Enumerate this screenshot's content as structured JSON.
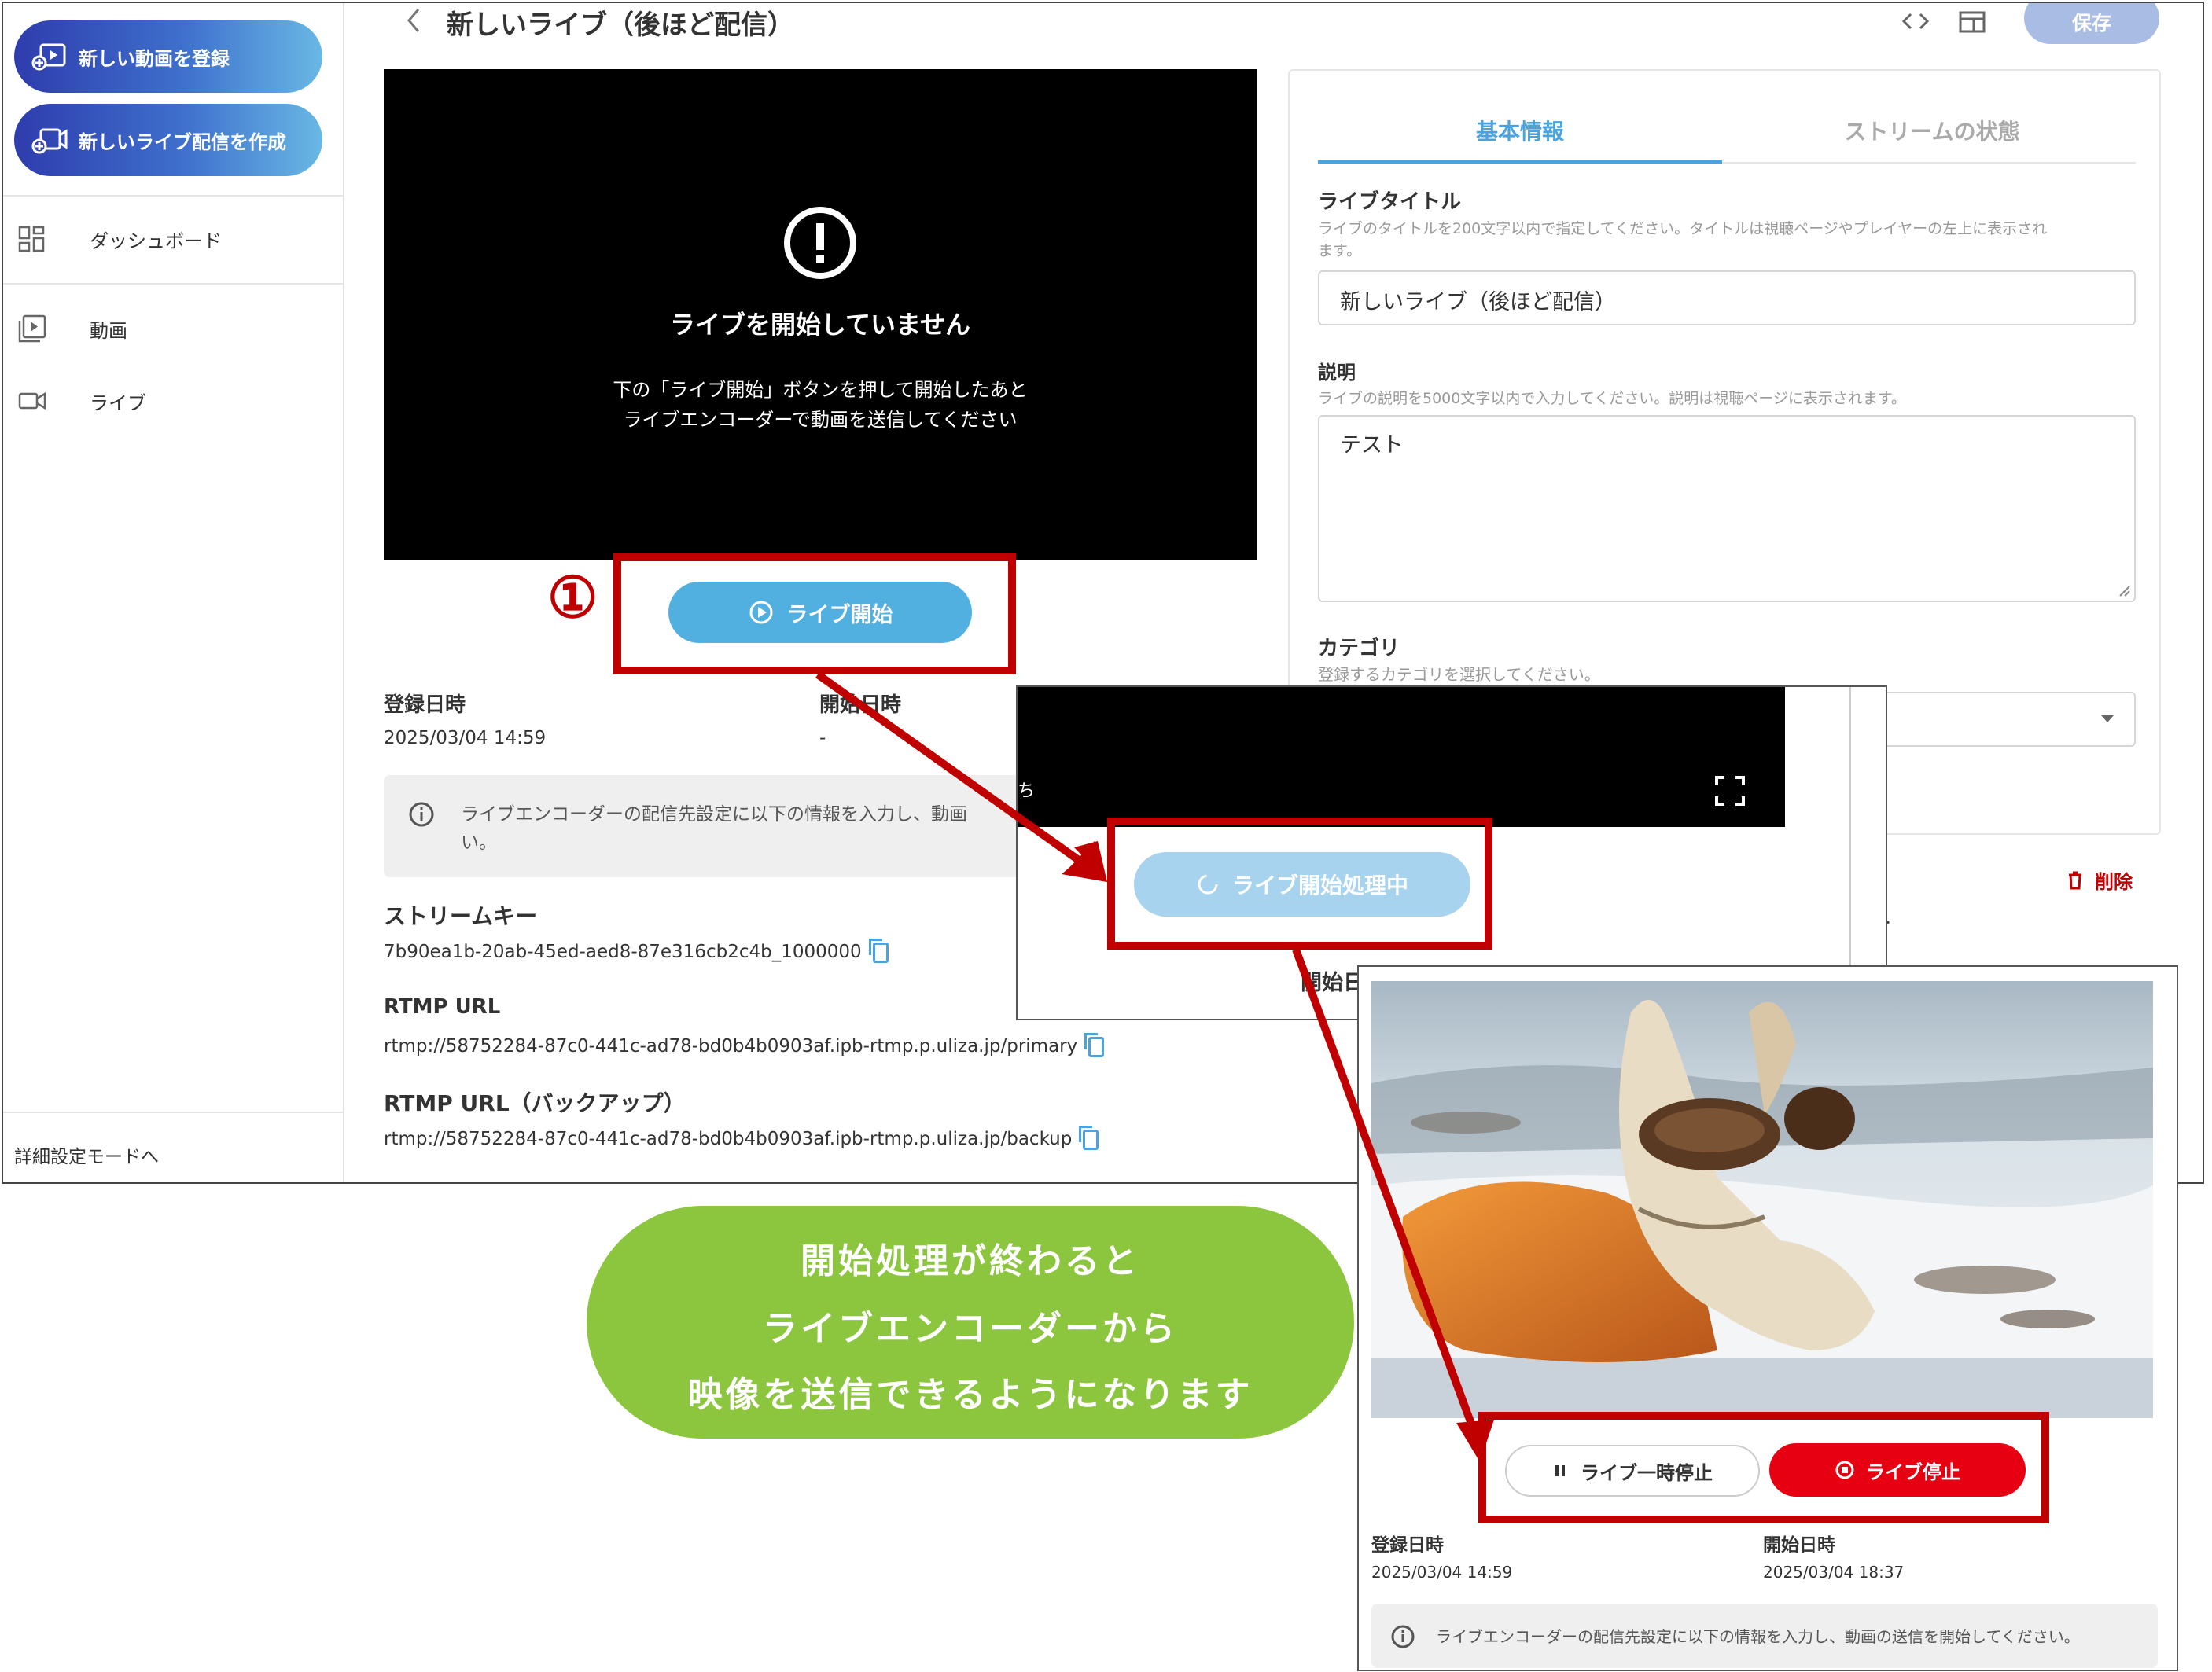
{
  "sidebar": {
    "register_video": "新しい動画を登録",
    "create_live": "新しいライブ配信を作成",
    "nav": [
      "ダッシュボード",
      "動画",
      "ライブ"
    ],
    "advanced_mode": "詳細設定モードへ"
  },
  "header": {
    "title": "新しいライブ（後ほど配信）",
    "save": "保存"
  },
  "player": {
    "heading": "ライブを開始していません",
    "line1": "下の「ライブ開始」ボタンを押して開始したあと",
    "line2": "ライブエンコーダーで動画を送信してください"
  },
  "step_marker": "①",
  "start_button": "ライブ開始",
  "info": {
    "registered_label": "登録日時",
    "registered_value": "2025/03/04 14:59",
    "started_label": "開始日時",
    "started_value": "-",
    "notice": "ライブエンコーダーの配信先設定に以下の情報を入力し、動画",
    "notice_tail": "い。",
    "stream_key_label": "ストリームキー",
    "stream_key": "7b90ea1b-20ab-45ed-aed8-87e316cb2c4b_1000000",
    "rtmp_label": "RTMP URL",
    "rtmp": "rtmp://58752284-87c0-441c-ad78-bd0b4b0903af.ipb-rtmp.p.uliza.jp/primary",
    "rtmp_backup_label": "RTMP URL（バックアップ）",
    "rtmp_backup": "rtmp://58752284-87c0-441c-ad78-bd0b4b0903af.ipb-rtmp.p.uliza.jp/backup"
  },
  "panel": {
    "tab_basic": "基本情報",
    "tab_stream": "ストリームの状態",
    "title_label": "ライブタイトル",
    "title_hint": "ライブのタイトルを200文字以内で指定してください。タイトルは視聴ページやプレイヤーの左上に表示され",
    "title_hint2": "ます。",
    "title_value": "新しいライブ（後ほど配信）",
    "desc_label": "説明",
    "desc_hint": "ライブの説明を5000文字以内で入力してください。説明は視聴ページに表示されます。",
    "desc_value": "テスト",
    "category_label": "カテゴリ",
    "category_hint": "登録するカテゴリを選択してください。",
    "delete": "削除",
    "cut_ka": "カテ",
    "cut_reg": "登録"
  },
  "overlay_mid": {
    "side_text": "ち",
    "processing": "ライブ開始処理中",
    "cut_start": "開始日"
  },
  "callout": {
    "line1": "開始処理が終わると",
    "line2": "ライブエンコーダーから",
    "line3": "映像を送信できるようになります"
  },
  "overlay_bottom": {
    "pause": "ライブ一時停止",
    "stop": "ライブ停止",
    "registered_label": "登録日時",
    "registered_value": "2025/03/04 14:59",
    "started_label": "開始日時",
    "started_value": "2025/03/04 18:37",
    "notice": "ライブエンコーダーの配信先設定に以下の情報を入力し、動画の送信を開始してください。"
  },
  "colors": {
    "accent": "#4aa3df",
    "annotation_red": "#c00000",
    "callout_green": "#8cc63f",
    "stop_red": "#e60012"
  }
}
